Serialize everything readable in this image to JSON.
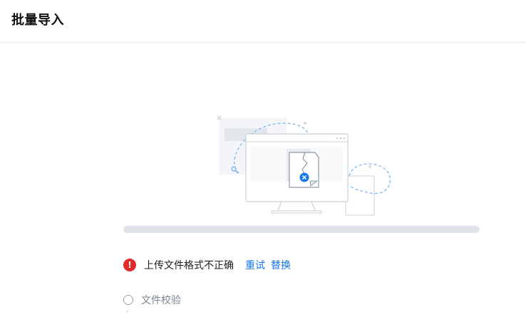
{
  "header": {
    "title": "批量导入"
  },
  "illustration": {
    "icon": "broken-file-monitor-icon",
    "colors": {
      "accent": "#1677e8",
      "outline": "#c9d0d8",
      "fill": "#eef1f5",
      "dashed": "#7fb8ee"
    }
  },
  "progress": {
    "value": 0
  },
  "status": {
    "icon": "error-icon",
    "text": "上传文件格式不正确",
    "retry_label": "重试",
    "replace_label": "替换",
    "color": "#e02b2b",
    "link_color": "#1677e8"
  },
  "check_step": {
    "icon": "radio-circle-icon",
    "label": "文件校验"
  }
}
